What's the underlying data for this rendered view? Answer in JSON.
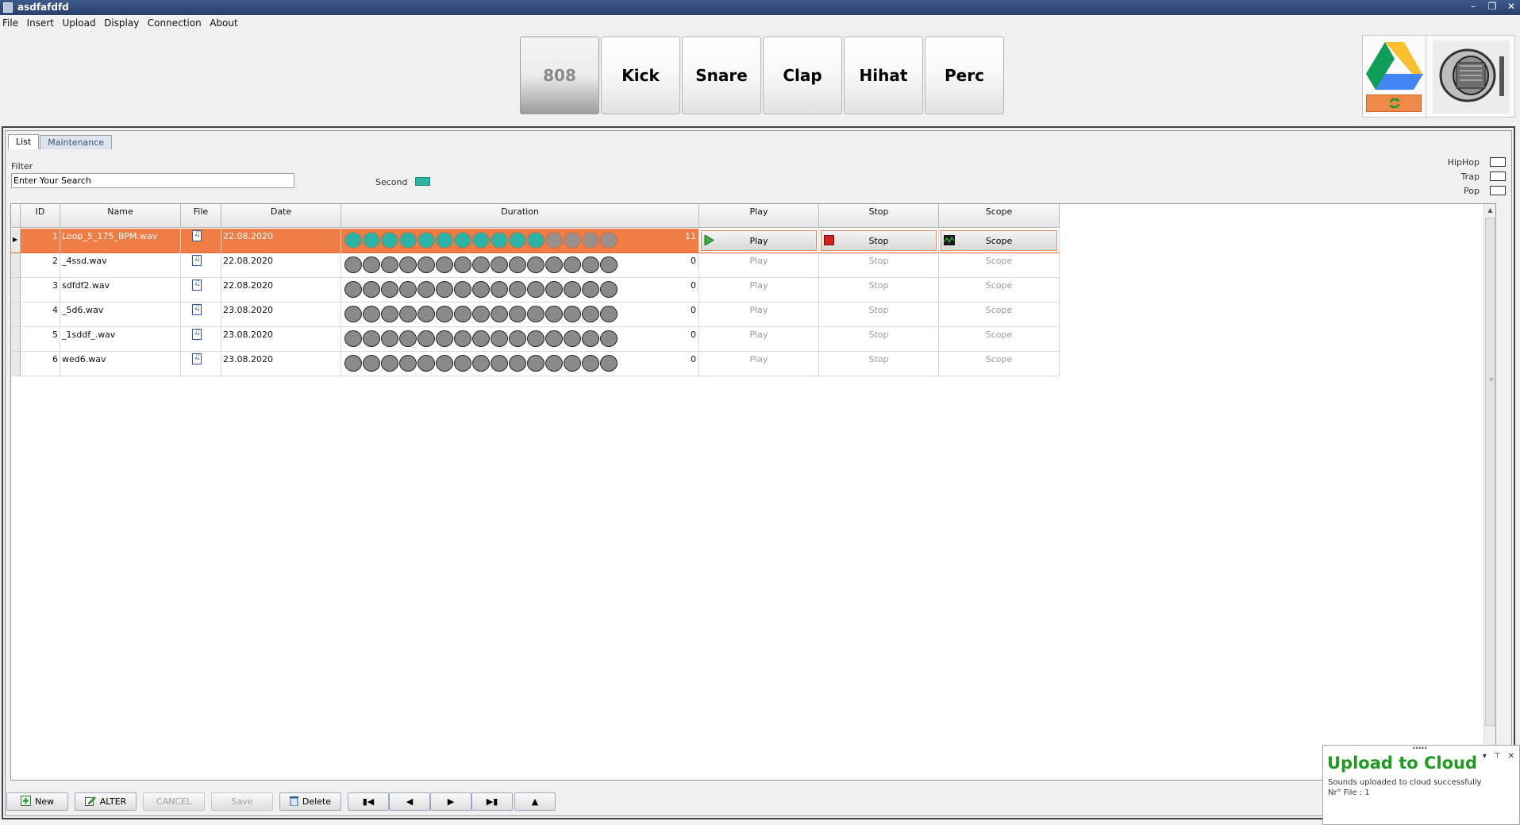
{
  "window": {
    "title": "asdfafdfd"
  },
  "menu": [
    "File",
    "Insert",
    "Upload",
    "Display",
    "Connection",
    "About"
  ],
  "categories": [
    "808",
    "Kick",
    "Snare",
    "Clap",
    "Hihat",
    "Perc"
  ],
  "active_category": "808",
  "tabs": [
    "List",
    "Maintenance"
  ],
  "filter": {
    "label": "Filter",
    "value": "Enter Your Search"
  },
  "legend": {
    "label": "Second",
    "color": "#2bb3a6"
  },
  "genres": [
    "HipHop",
    "Trap",
    "Pop"
  ],
  "columns": [
    "ID",
    "Name",
    "File",
    "Date",
    "Duration",
    "Play",
    "Stop",
    "Scope"
  ],
  "rows": [
    {
      "id": "1",
      "name": "Loop_5_175_BPM.wav",
      "date": "22.08.2020",
      "duration": "11",
      "lit": 11,
      "play": "Play",
      "stop": "Stop",
      "scope": "Scope",
      "selected": true
    },
    {
      "id": "2",
      "name": "_4ssd.wav",
      "date": "22.08.2020",
      "duration": "0",
      "lit": 0,
      "play": "Play",
      "stop": "Stop",
      "scope": "Scope"
    },
    {
      "id": "3",
      "name": "sdfdf2.wav",
      "date": "22.08.2020",
      "duration": "0",
      "lit": 0,
      "play": "Play",
      "stop": "Stop",
      "scope": "Scope"
    },
    {
      "id": "4",
      "name": "_5d6.wav",
      "date": "23.08.2020",
      "duration": "0",
      "lit": 0,
      "play": "Play",
      "stop": "Stop",
      "scope": "Scope"
    },
    {
      "id": "5",
      "name": "_1sddf_.wav",
      "date": "23.08.2020",
      "duration": "0",
      "lit": 0,
      "play": "Play",
      "stop": "Stop",
      "scope": "Scope"
    },
    {
      "id": "6",
      "name": "wed6.wav",
      "date": "23.08.2020",
      "duration": "0",
      "lit": 0,
      "play": "Play",
      "stop": "Stop",
      "scope": "Scope"
    }
  ],
  "duration_dots_total": 15,
  "bottom_buttons": {
    "new": "New",
    "alter": "ALTER",
    "cancel": "CANCEL",
    "save": "Save",
    "delete": "Delete"
  },
  "toast": {
    "title": "Upload to Cloud",
    "line1": "Sounds uploaded to cloud successfully",
    "line2": "Nr° File : 1"
  },
  "colors": {
    "selected_row": "#f07d45",
    "accent": "#2bb3a6",
    "toast_title": "#1e9a20",
    "sync": "#f08a4b"
  }
}
